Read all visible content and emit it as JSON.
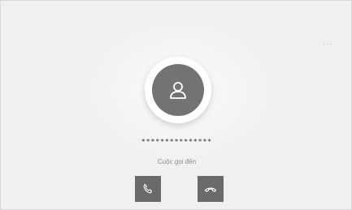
{
  "menu": {
    "more_icon": "more-icon",
    "more_glyph": "···"
  },
  "caller": {
    "avatar_icon": "person-icon",
    "number": "***************",
    "status": "Cuộc gọi đến"
  },
  "actions": {
    "accept_icon": "phone-icon",
    "decline_icon": "hang-up-icon"
  },
  "colors": {
    "background": "#f0f0f0",
    "avatar": "#737373",
    "button": "#6a6a6a",
    "text": "#8a8a8a"
  }
}
